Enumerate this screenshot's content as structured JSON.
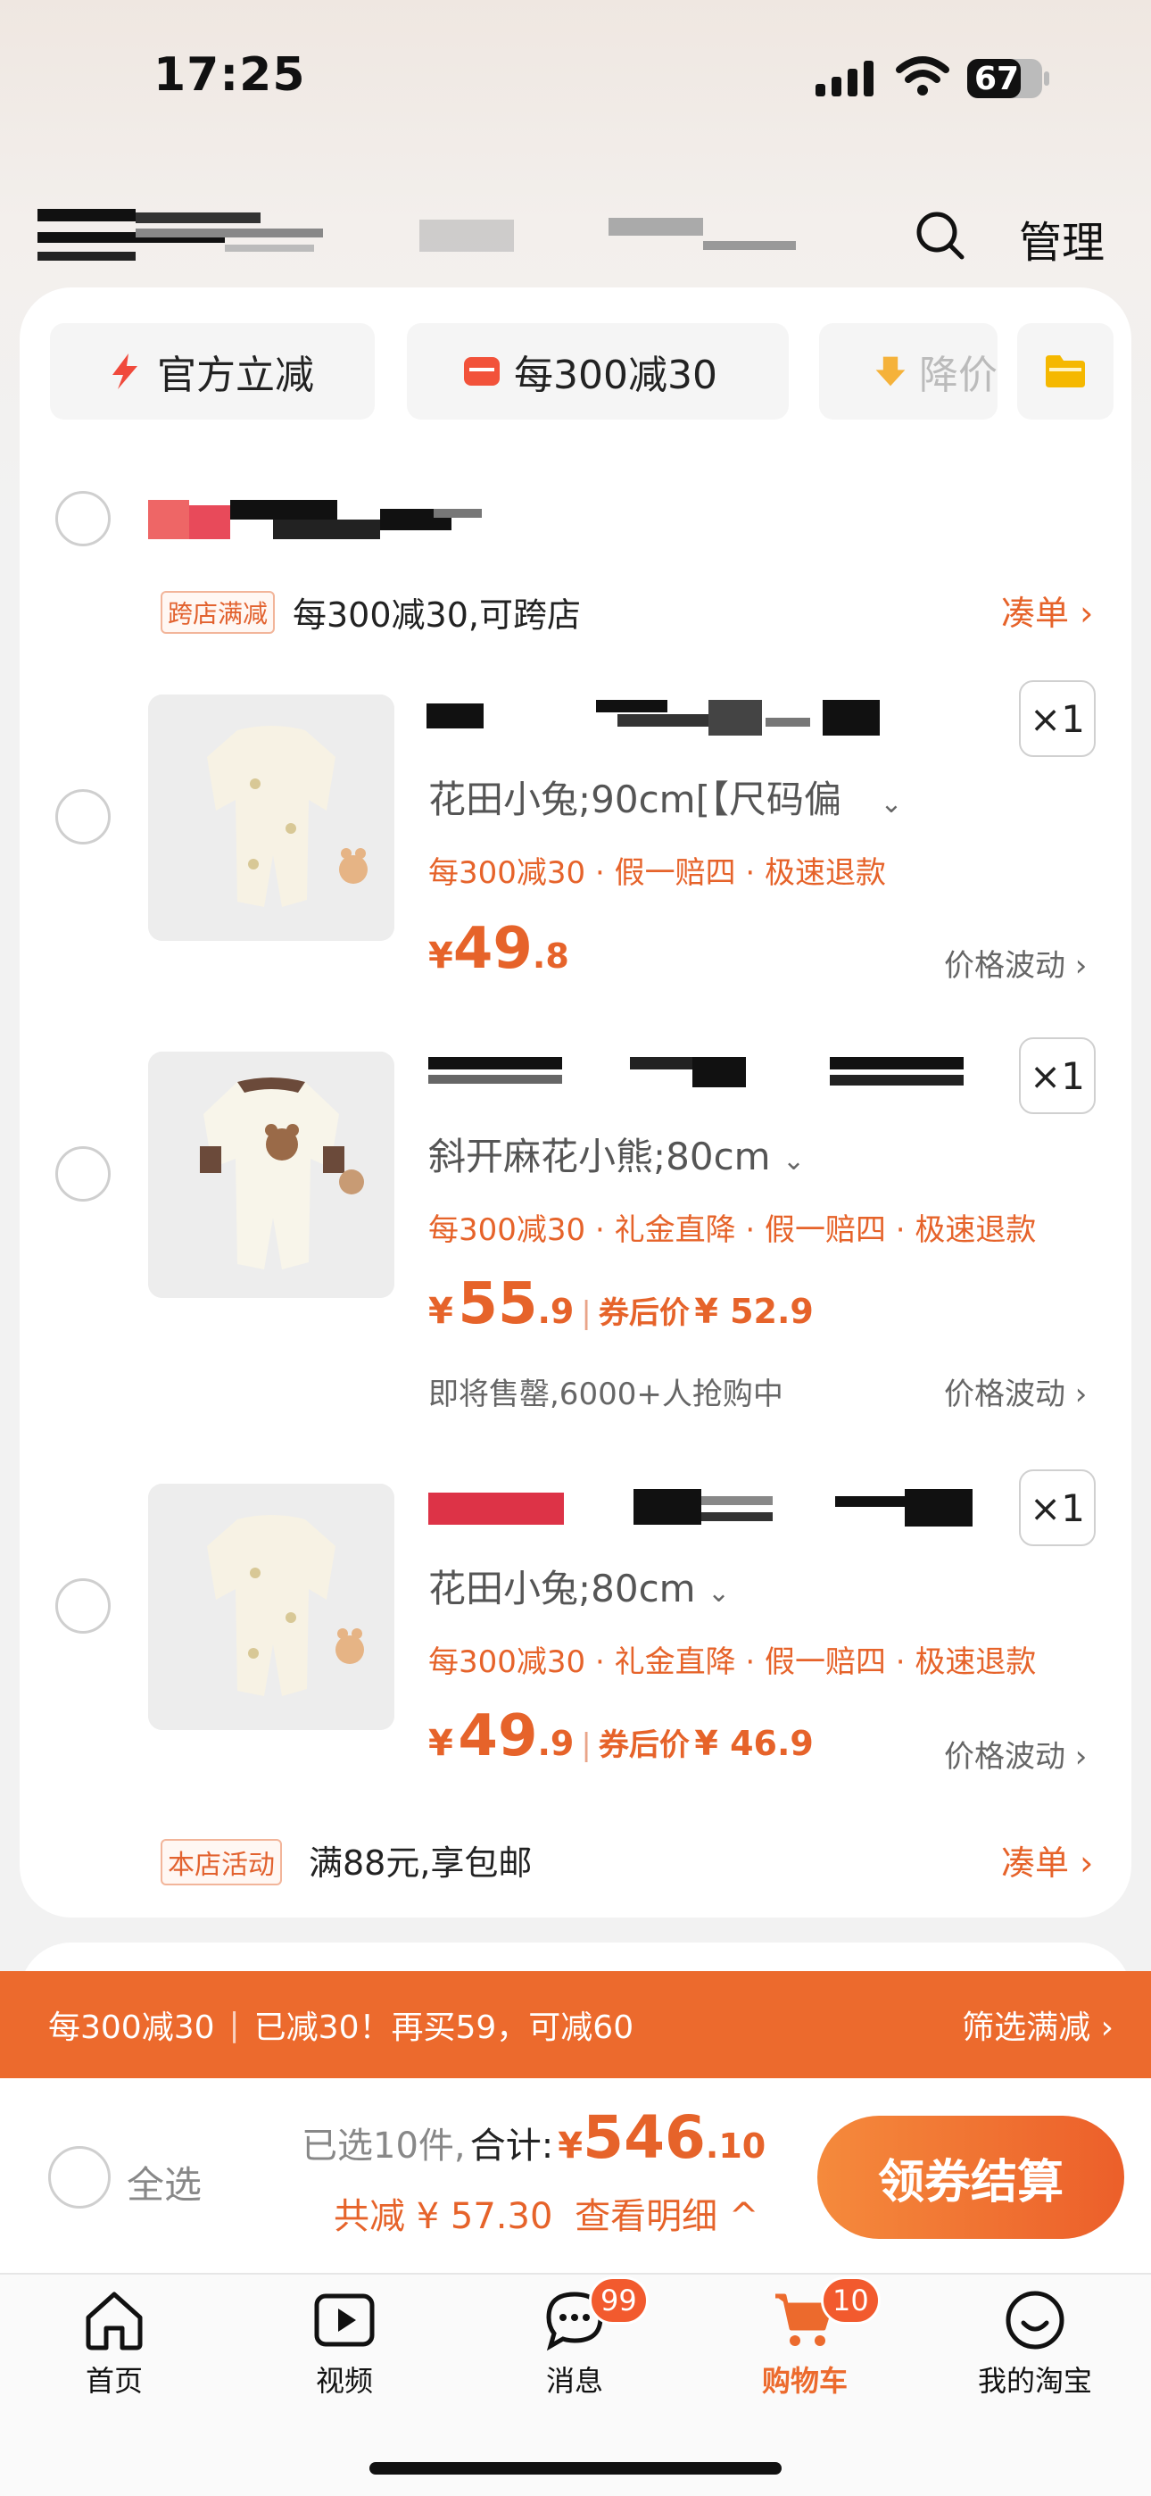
{
  "status_bar": {
    "time": "17:25",
    "battery": "67"
  },
  "header": {
    "manage_label": "管理"
  },
  "chips": [
    {
      "label": "官方立减",
      "icon": "lightning-icon"
    },
    {
      "label": "每300减30",
      "icon": "coupon-icon"
    },
    {
      "label": "降价",
      "icon": "down-arrow-icon"
    }
  ],
  "store": {
    "promo_tag": "跨店满减",
    "promo_text": "每300减30,可跨店",
    "promo_link": "凑单 ›",
    "activity_tag": "本店活动",
    "activity_text": "满88元,享包邮",
    "activity_link": "凑单 ›"
  },
  "items": [
    {
      "sku": "花田小兔;90cm[【尺码偏",
      "promos": "每300减30 · 假一赔四 · 极速退款",
      "price_symbol": "¥",
      "price_int": "49",
      "price_dec": ".8",
      "coupon_label": "",
      "coupon_price": "",
      "note": "",
      "trend": "价格波动 ›",
      "qty": "×1"
    },
    {
      "sku": "斜开麻花小熊;80cm",
      "promos": "每300减30 · 礼金直降 · 假一赔四 · 极速退款",
      "price_symbol": "¥",
      "price_int": "55",
      "price_dec": ".9",
      "coupon_label": "券后价",
      "coupon_price": "¥ 52.9",
      "note": "即将售罄,6000+人抢购中",
      "trend": "价格波动 ›",
      "qty": "×1"
    },
    {
      "sku": "花田小兔;80cm",
      "promos": "每300减30 · 礼金直降 · 假一赔四 · 极速退款",
      "price_symbol": "¥",
      "price_int": "49",
      "price_dec": ".9",
      "coupon_label": "券后价",
      "coupon_price": "¥ 46.9",
      "note": "",
      "trend": "价格波动 ›",
      "qty": "×1"
    }
  ],
  "banner": {
    "left": "每300减30",
    "middle": "已减30！再买59，可减60",
    "right": "筛选满减 ›"
  },
  "checkout": {
    "select_all": "全选",
    "selected": "已选10件,",
    "total_label": "合计:",
    "total_symbol": "¥",
    "total_int": "546",
    "total_dec": ".10",
    "discount": "共减 ¥ 57.30",
    "detail": "查看明细 ^",
    "button": "领券结算"
  },
  "tabbar": [
    {
      "label": "首页",
      "icon": "home-icon"
    },
    {
      "label": "视频",
      "icon": "video-icon"
    },
    {
      "label": "消息",
      "icon": "message-icon",
      "badge": "99"
    },
    {
      "label": "购物车",
      "icon": "cart-icon",
      "badge": "10"
    },
    {
      "label": "我的淘宝",
      "icon": "profile-icon"
    }
  ],
  "colors": {
    "accent": "#e6632a",
    "banner": "#ec6a2d"
  }
}
